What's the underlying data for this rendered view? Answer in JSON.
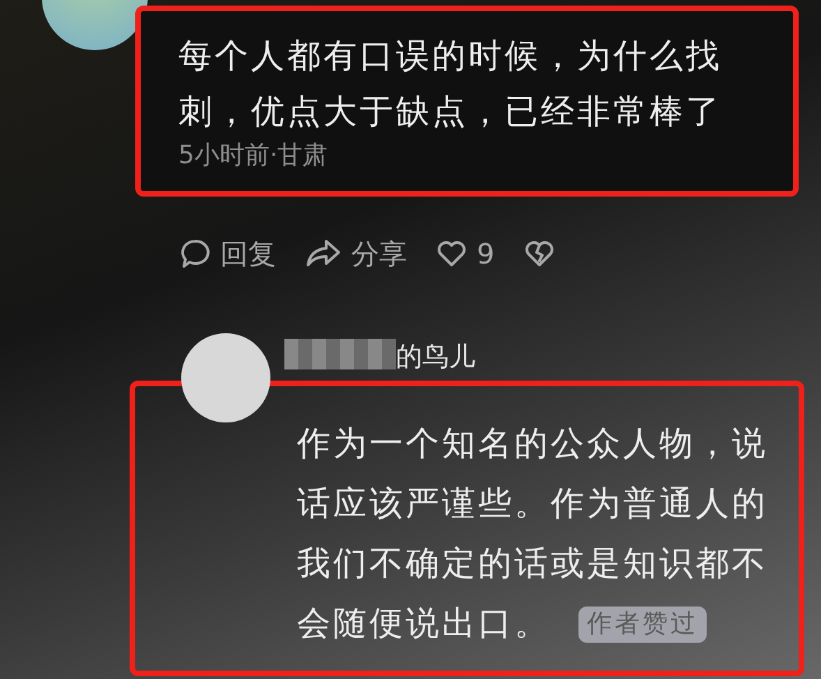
{
  "comments": [
    {
      "text": "每个人都有口误的时候，为什么找刺，优点大于缺点，已经非常棒了",
      "meta": "5小时前·甘肃",
      "highlighted": true,
      "actions": [
        {
          "kind": "reply",
          "label": "回复"
        },
        {
          "kind": "share",
          "label": "分享"
        },
        {
          "kind": "like",
          "label": "9"
        },
        {
          "kind": "dislike"
        }
      ]
    },
    {
      "username": "的鸟儿",
      "username_masked": true,
      "text": "作为一个知名的公众人物，说话应该严谨些。作为普通人的我们不确定的话或是知识都不会随便说出口。",
      "badge": "作者赞过",
      "highlighted": true
    }
  ]
}
